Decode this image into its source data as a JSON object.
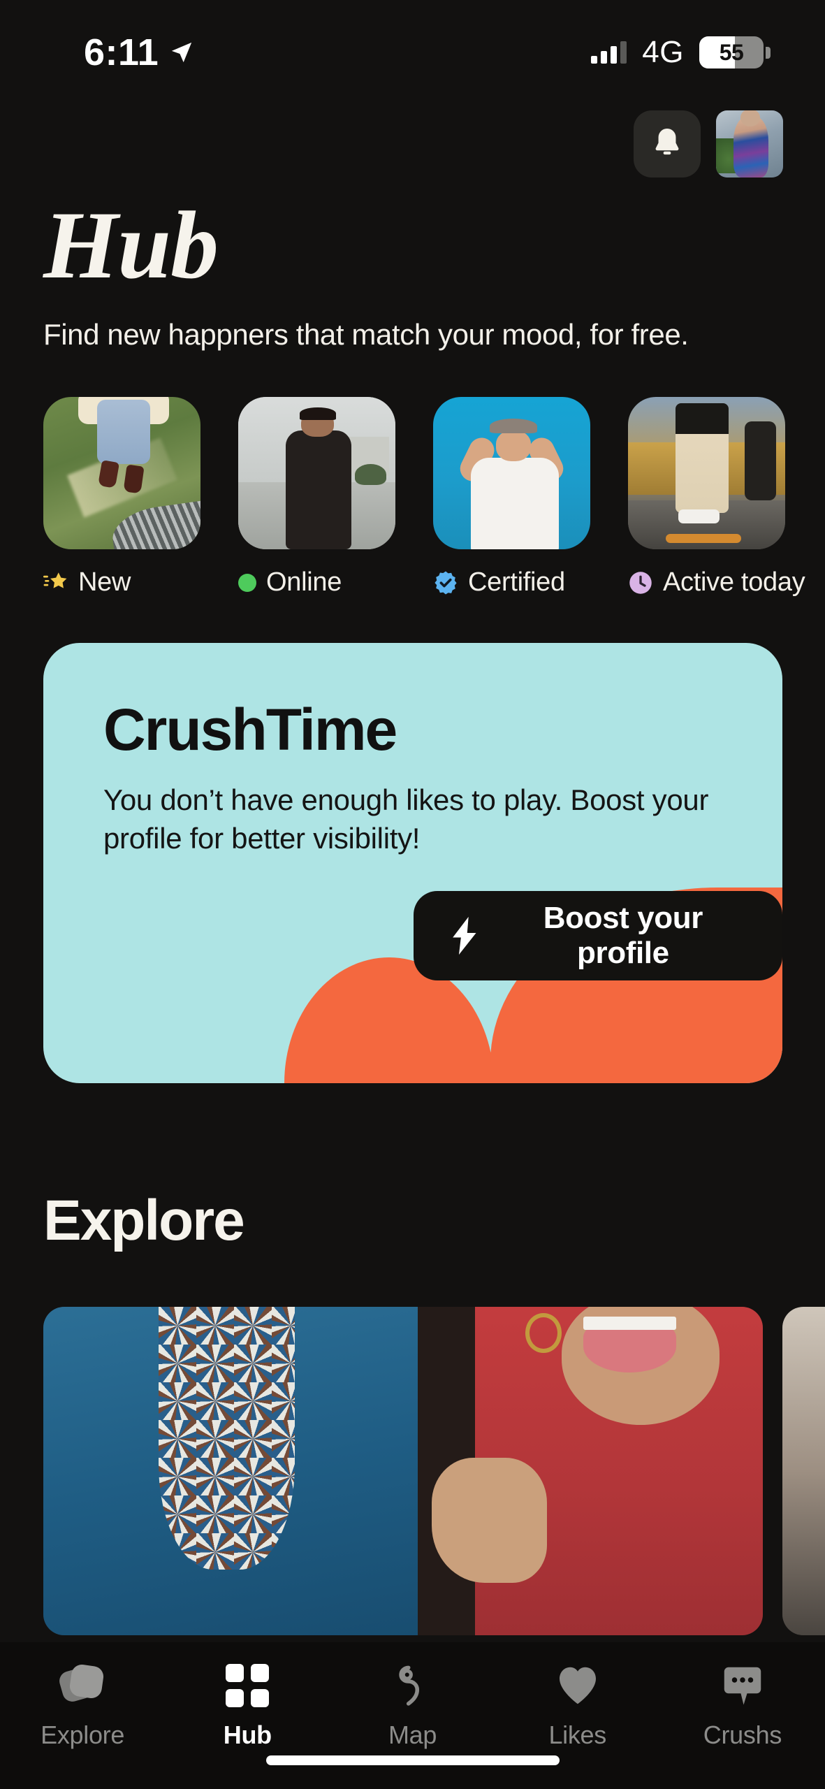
{
  "status_bar": {
    "time": "6:11",
    "location_icon": "location-arrow-icon",
    "signal_icon": "cellular-signal-icon",
    "signal_bars_filled": 3,
    "network": "4G",
    "battery_percent": "55",
    "battery_level": 55
  },
  "header": {
    "notifications_icon": "bell-icon",
    "avatar_label": "profile-avatar",
    "title": "Hub",
    "subtitle": "Find new happners that match your mood, for free."
  },
  "categories": [
    {
      "label": "New",
      "icon": "shooting-star-icon",
      "icon_color": "#F2C94C"
    },
    {
      "label": "Online",
      "icon": "green-dot-icon",
      "icon_color": "#4ECB5C"
    },
    {
      "label": "Certified",
      "icon": "verified-badge-icon",
      "icon_color": "#5CB3F0"
    },
    {
      "label": "Active today",
      "icon": "clock-icon",
      "icon_color": "#D9B3E6"
    }
  ],
  "crushtime": {
    "title": "CrushTime",
    "body": "You don’t have enough likes to play. Boost your profile for better visibility!",
    "cta_label": "Boost your profile",
    "cta_icon": "lightning-bolt-icon",
    "card_color": "#AEE4E4",
    "accent_color": "#F4683F",
    "cta_bg": "#131210"
  },
  "explore": {
    "title": "Explore"
  },
  "bottom_nav": {
    "items": [
      {
        "label": "Explore",
        "icon": "cards-stack-icon",
        "active": false
      },
      {
        "label": "Hub",
        "icon": "grid-icon",
        "active": true
      },
      {
        "label": "Map",
        "icon": "route-path-icon",
        "active": false
      },
      {
        "label": "Likes",
        "icon": "heart-icon",
        "active": false
      },
      {
        "label": "Crushs",
        "icon": "chat-bubble-icon",
        "active": false
      }
    ],
    "active_color": "#FFFFFF",
    "inactive_color": "#8C8C8A"
  }
}
